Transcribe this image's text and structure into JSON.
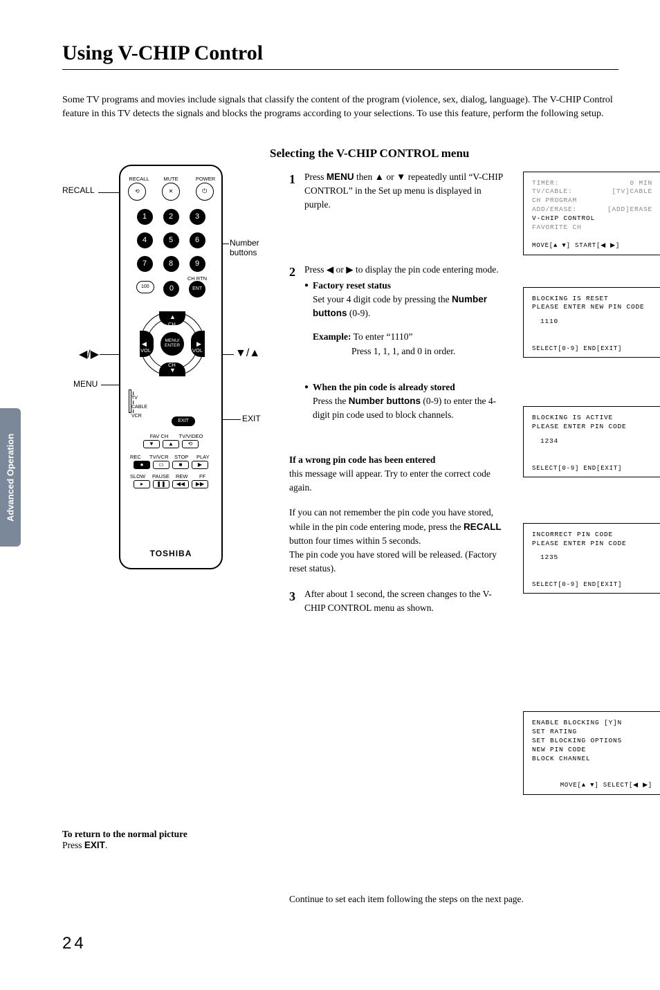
{
  "side_tab": "Advanced Operation",
  "title": "Using V-CHIP Control",
  "intro": "Some TV programs and movies include signals that classify the content of the program (violence, sex, dialog, language). The V-CHIP Control feature in this TV detects the signals and blocks the programs according to your selections. To use this feature, perform the following setup.",
  "section_heading": "Selecting the V-CHIP CONTROL menu",
  "steps": {
    "s1": {
      "num": "1",
      "pre": "Press ",
      "menu_btn": "MENU",
      "mid": " then ▲ or ▼ repeatedly until “V-CHIP CONTROL” in the Set up menu is displayed in purple."
    },
    "s2": {
      "num": "2",
      "text": "Press ◀ or ▶ to display the pin code entering mode.",
      "bullet1_title": "Factory reset status",
      "bullet1_body_pre": "Set your 4 digit code by pressing the ",
      "bullet1_btn": "Number buttons",
      "bullet1_body_post": " (0-9).",
      "example_label": "Example:",
      "example_a": " To enter “1110”",
      "example_b": "Press 1, 1, 1, and 0 in order.",
      "bullet2_title": "When the pin code is already stored",
      "bullet2_body_pre": "Press the ",
      "bullet2_btn": "Number buttons",
      "bullet2_body_post": " (0-9) to enter the 4-digit pin code used to block channels."
    },
    "wrong": {
      "title": "If a wrong pin code has been entered",
      "body1": "this message will appear. Try to enter the correct code again.",
      "body2_pre": "If you can not remember the pin code you have stored, while in the pin code entering mode, press the ",
      "body2_btn": "RECALL",
      "body2_post": " button four times within 5 seconds.",
      "body3": "The pin code you have stored will be released. (Factory reset status)."
    },
    "s3": {
      "num": "3",
      "text": "After about 1 second, the screen changes to the V-CHIP CONTROL menu as shown."
    }
  },
  "return_note": {
    "title": "To return to the normal picture",
    "body_pre": "Press ",
    "btn": "EXIT",
    "body_post": "."
  },
  "continue_note": "Continue to set each item following the steps on the next page.",
  "page_number": "24",
  "osd": {
    "setup": {
      "l1a": "TIMER:",
      "l1b": "0 MIN",
      "l2a": "TV/CABLE:",
      "l2b": "[TV]CABLE",
      "l3": "CH PROGRAM",
      "l4a": "ADD/ERASE:",
      "l4b": "[ADD]ERASE",
      "l5": "V-CHIP CONTROL",
      "l6": "FAVORITE CH",
      "footer": "MOVE[▲ ▼] START[◀ ▶]"
    },
    "reset": {
      "l1": "BLOCKING IS RESET",
      "l2": "PLEASE ENTER NEW PIN CODE",
      "l3": "1110",
      "footer": "SELECT[0-9] END[EXIT]"
    },
    "active": {
      "l1": "BLOCKING IS ACTIVE",
      "l2": "PLEASE ENTER PIN CODE",
      "l3": "1234",
      "footer": "SELECT[0-9] END[EXIT]"
    },
    "incorrect": {
      "l1": "INCORRECT PIN CODE",
      "l2": "PLEASE ENTER PIN CODE",
      "l3": "1235",
      "footer": "SELECT[0-9] END[EXIT]"
    },
    "vchip": {
      "l1": "ENABLE BLOCKING [Y]N",
      "l2": "SET RATING",
      "l3": "SET BLOCKING OPTIONS",
      "l4": "NEW PIN CODE",
      "l5": "BLOCK CHANNEL",
      "footer": "MOVE[▲ ▼] SELECT[◀ ▶]"
    }
  },
  "remote": {
    "callouts": {
      "recall": "RECALL",
      "number": "Number buttons",
      "arrows_lr": "◀/▶",
      "arrows_ud": "▼/▲",
      "menu": "MENU",
      "exit": "EXIT"
    },
    "labels": {
      "recall": "RECALL",
      "mute": "MUTE",
      "power": "POWER",
      "ch_rtn": "CH RTN",
      "ent": "ENT",
      "ch_up": "CH",
      "ch_dn": "CH",
      "vol": "VOL",
      "menu_enter": "MENU/\nENTER",
      "tv": "TV",
      "cable": "CABLE",
      "vcr": "VCR",
      "exit": "EXIT",
      "fav_ch": "FAV CH",
      "tv_video": "TV/VIDEO",
      "rec": "REC",
      "tvvcr": "TV/VCR",
      "stop": "STOP",
      "play": "PLAY",
      "slow": "SLOW",
      "pause": "PAUSE",
      "rew": "REW",
      "ff": "FF",
      "brand": "TOSHIBA",
      "n1": "1",
      "n2": "2",
      "n3": "3",
      "n4": "4",
      "n5": "5",
      "n6": "6",
      "n7": "7",
      "n8": "8",
      "n9": "9",
      "n0": "0",
      "n100": "100"
    }
  }
}
